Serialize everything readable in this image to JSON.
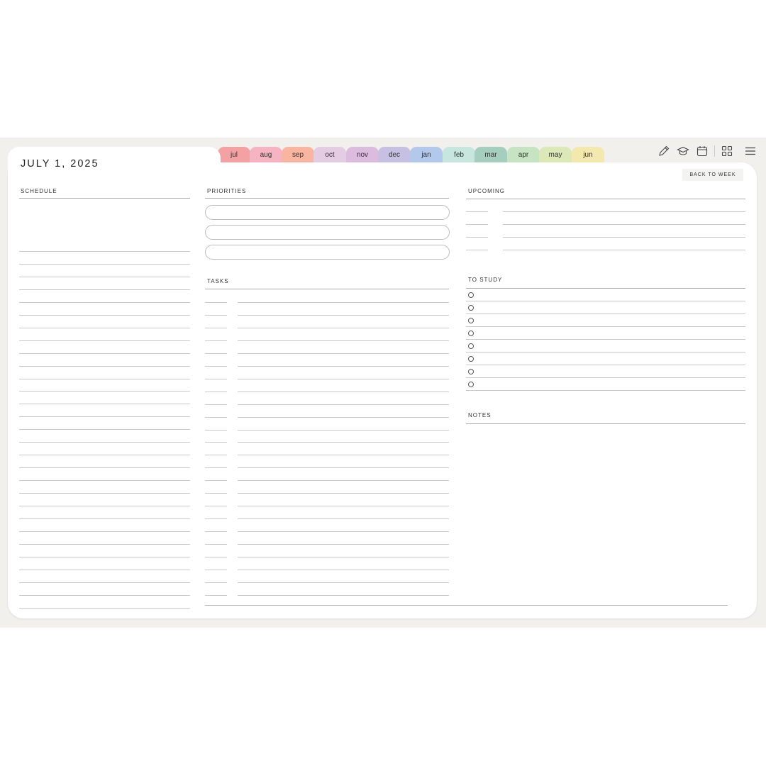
{
  "header": {
    "date_title": "JULY 1, 2025",
    "back_to_week_label": "BACK TO WEEK"
  },
  "month_tabs": [
    {
      "label": "jul",
      "color": "#f4a1a4"
    },
    {
      "label": "aug",
      "color": "#f6b3c1"
    },
    {
      "label": "sep",
      "color": "#f9b5a0"
    },
    {
      "label": "oct",
      "color": "#e4cce3"
    },
    {
      "label": "nov",
      "color": "#dbbcdf"
    },
    {
      "label": "dec",
      "color": "#c6c0e3"
    },
    {
      "label": "jan",
      "color": "#b2c9ec"
    },
    {
      "label": "feb",
      "color": "#c7e6dd"
    },
    {
      "label": "mar",
      "color": "#a6cebe"
    },
    {
      "label": "apr",
      "color": "#c6e4c1"
    },
    {
      "label": "may",
      "color": "#dbe8b7"
    },
    {
      "label": "jun",
      "color": "#f3e9ae"
    }
  ],
  "toolbar": {
    "icons": [
      "pencil-icon",
      "graduation-cap-icon",
      "calendar-icon",
      "grid-icon",
      "menu-icon"
    ]
  },
  "sections": {
    "schedule": "SCHEDULE",
    "priorities": "PRIORITIES",
    "tasks": "TASKS",
    "upcoming": "UPCOMING",
    "to_study": "TO STUDY",
    "notes": "NOTES"
  }
}
